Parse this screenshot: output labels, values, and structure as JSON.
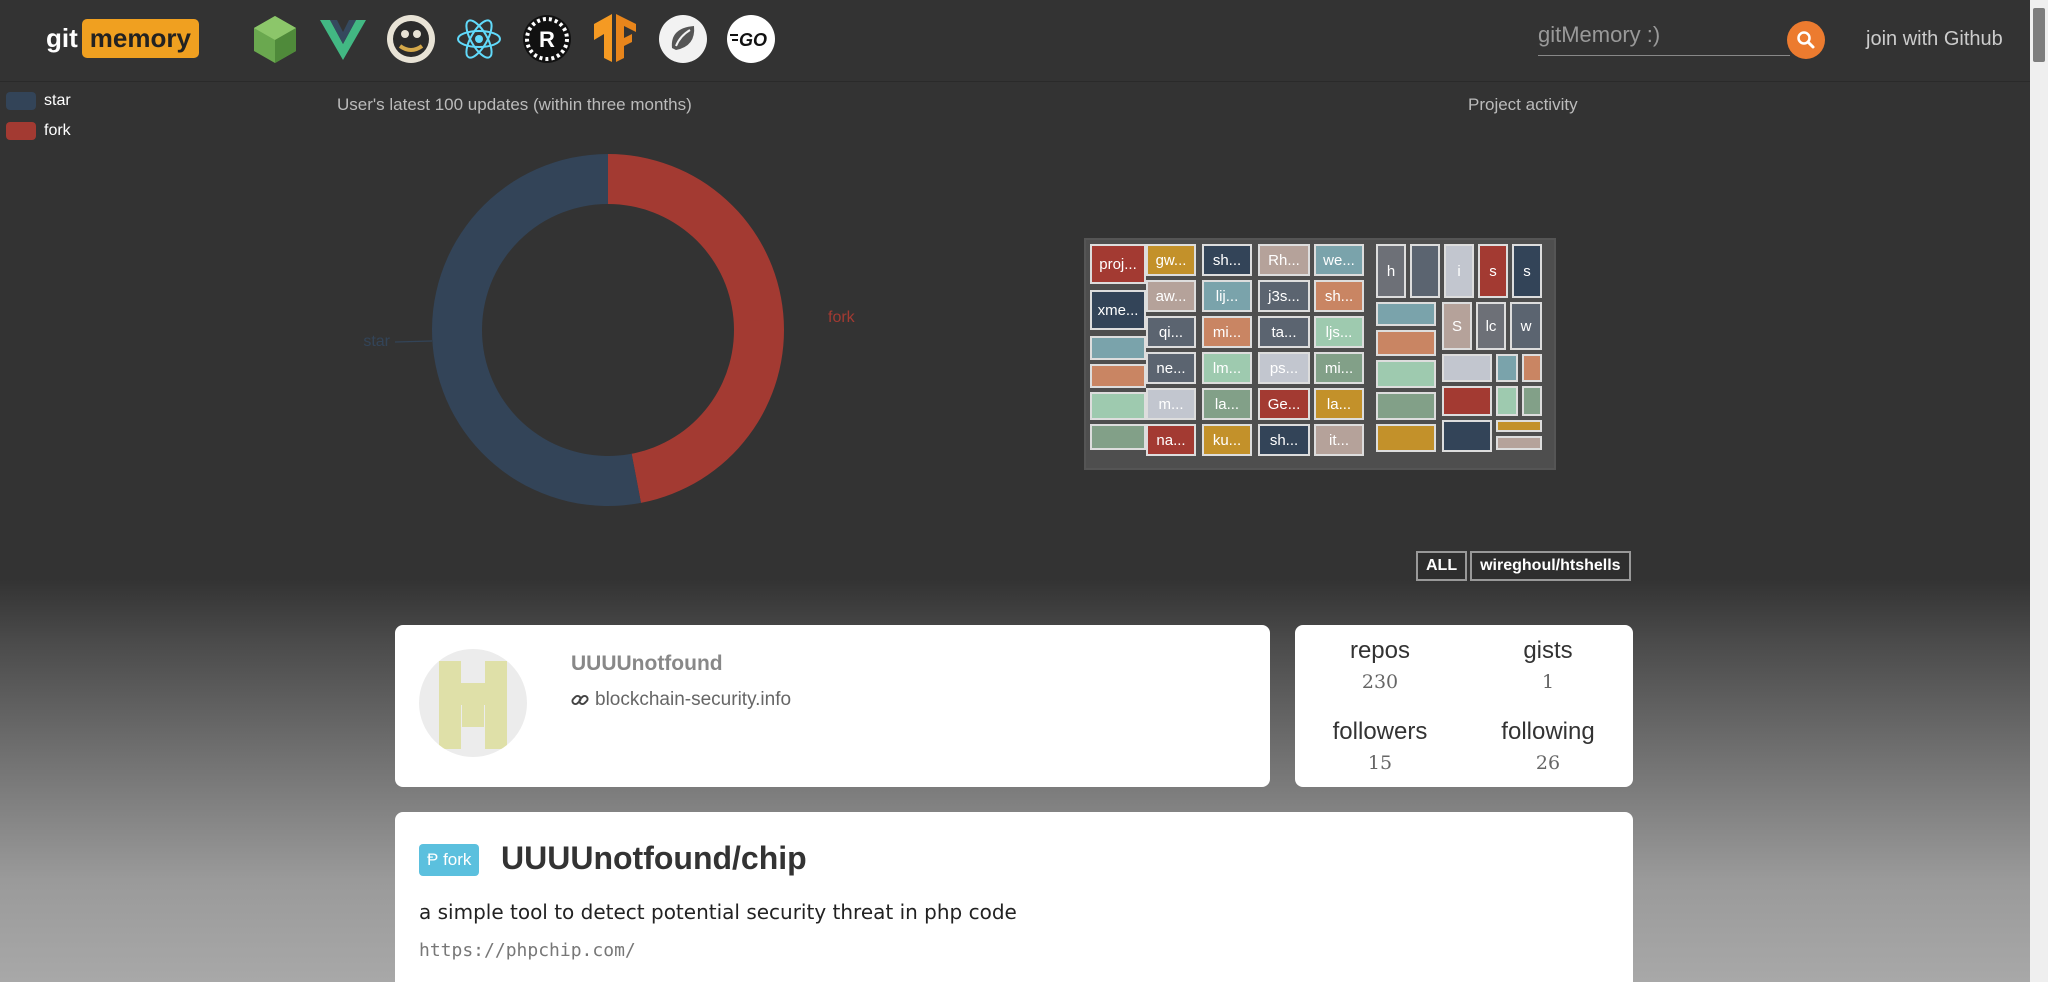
{
  "navbar": {
    "logo_git": "git",
    "logo_memory": "memory",
    "tech_icons": [
      "nodejs-icon",
      "vue-icon",
      "rust-crab-icon",
      "react-icon",
      "rust-icon",
      "tensorflow-icon",
      "spring-icon",
      "go-icon"
    ],
    "search_placeholder": "gitMemory :)",
    "join_label": "join with Github"
  },
  "legend": {
    "items": [
      {
        "label": "star",
        "color": "#334458"
      },
      {
        "label": "fork",
        "color": "#a33a32"
      }
    ]
  },
  "donut": {
    "title": "User's latest 100 updates (within three months)",
    "star_label": "star",
    "fork_label": "fork"
  },
  "chart_data": {
    "type": "pie",
    "title": "User's latest 100 updates (within three months)",
    "categories": [
      "star",
      "fork"
    ],
    "values": [
      53,
      47
    ],
    "colors": [
      "#334458",
      "#a33a32"
    ]
  },
  "treemap": {
    "title": "Project activity",
    "cells": [
      {
        "label": "proj...",
        "color": "#a33a32"
      },
      {
        "label": "gw...",
        "color": "#c3912a"
      },
      {
        "label": "sh...",
        "color": "#334458"
      },
      {
        "label": "Rh...",
        "color": "#b5a29a"
      },
      {
        "label": "we...",
        "color": "#7aa3ab"
      },
      {
        "label": "h",
        "color": "#6d7077"
      },
      {
        "label": "",
        "color": "#5b6470"
      },
      {
        "label": "i",
        "color": "#c2c6cf"
      },
      {
        "label": "s",
        "color": "#a33a32"
      },
      {
        "label": "s",
        "color": "#334458"
      },
      {
        "label": "xme...",
        "color": "#334458"
      },
      {
        "label": "aw...",
        "color": "#b5a29a"
      },
      {
        "label": "lij...",
        "color": "#7aa3ab"
      },
      {
        "label": "j3s...",
        "color": "#5b6470"
      },
      {
        "label": "sh...",
        "color": "#c98563"
      },
      {
        "label": "",
        "color": "#7aa3ab"
      },
      {
        "label": "S",
        "color": "#b5a29a"
      },
      {
        "label": "lc",
        "color": "#6d7077"
      },
      {
        "label": "w",
        "color": "#5b6470"
      },
      {
        "label": "",
        "color": "#7aa3ab"
      },
      {
        "label": "qi...",
        "color": "#5b6470"
      },
      {
        "label": "mi...",
        "color": "#c98563"
      },
      {
        "label": "ta...",
        "color": "#5b6470"
      },
      {
        "label": "ljs...",
        "color": "#9ecaaf"
      },
      {
        "label": "",
        "color": "#c98563"
      },
      {
        "label": "",
        "color": "#c98563"
      },
      {
        "label": "ne...",
        "color": "#5b6470"
      },
      {
        "label": "lm...",
        "color": "#9ecaaf"
      },
      {
        "label": "ps...",
        "color": "#c2c6cf"
      },
      {
        "label": "mi...",
        "color": "#82a088"
      },
      {
        "label": "",
        "color": "#9ecaaf"
      },
      {
        "label": "",
        "color": "#c2c6cf"
      },
      {
        "label": "",
        "color": "#7aa3ab"
      },
      {
        "label": "",
        "color": "#c98563"
      },
      {
        "label": "",
        "color": "#9ecaaf"
      },
      {
        "label": "m...",
        "color": "#c2c6cf"
      },
      {
        "label": "la...",
        "color": "#82a088"
      },
      {
        "label": "Ge...",
        "color": "#a33a32"
      },
      {
        "label": "la...",
        "color": "#c3912a"
      },
      {
        "label": "",
        "color": "#82a088"
      },
      {
        "label": "",
        "color": "#a33a32"
      },
      {
        "label": "",
        "color": "#9ecaaf"
      },
      {
        "label": "",
        "color": "#82a088"
      },
      {
        "label": "",
        "color": "#82a088"
      },
      {
        "label": "na...",
        "color": "#a33a32"
      },
      {
        "label": "ku...",
        "color": "#c3912a"
      },
      {
        "label": "sh...",
        "color": "#334458"
      },
      {
        "label": "it...",
        "color": "#b5a29a"
      },
      {
        "label": "",
        "color": "#c3912a"
      },
      {
        "label": "",
        "color": "#334458"
      },
      {
        "label": "",
        "color": "#c3912a"
      },
      {
        "label": "",
        "color": "#b5a29a"
      }
    ]
  },
  "breadcrumb": {
    "root": "ALL",
    "current": "wireghoul/htshells"
  },
  "profile": {
    "username": "UUUUnotfound",
    "website": "blockchain-security.info"
  },
  "stats": {
    "repos_label": "repos",
    "repos": "230",
    "gists_label": "gists",
    "gists": "1",
    "followers_label": "followers",
    "followers": "15",
    "following_label": "following",
    "following": "26"
  },
  "repo": {
    "badge": "fork",
    "name": "UUUUnotfound/chip",
    "description": "a simple tool to detect potential security threat in php code",
    "link": "https://phpchip.com/"
  }
}
